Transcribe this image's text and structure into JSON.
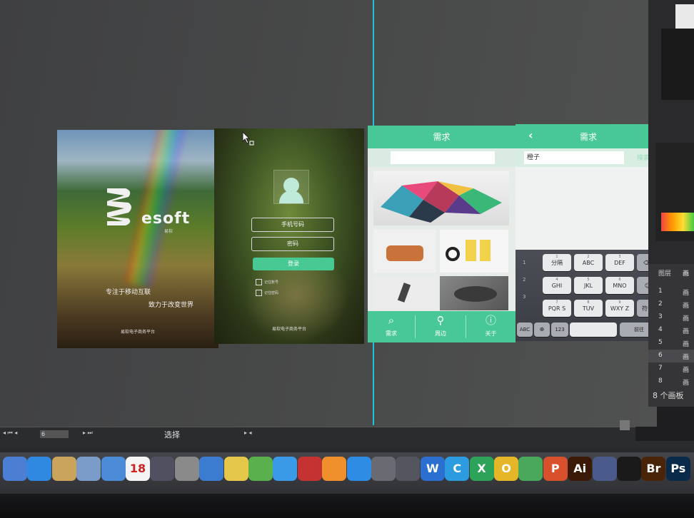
{
  "artboard1": {
    "brand": "esoft",
    "brand_sub": "易软",
    "tagline1": "专注于移动互联",
    "tagline2": "致力于改变世界",
    "footer": "易软电子商务平台"
  },
  "artboard2": {
    "phone_placeholder": "手机号码",
    "password_placeholder": "密码",
    "login_label": "登录",
    "remember_account": "记住账号",
    "remember_password": "记住密码",
    "footer": "易软电子商务平台"
  },
  "artboard3": {
    "title": "需求",
    "tabs": [
      {
        "icon": "search-icon",
        "label": "需求"
      },
      {
        "icon": "location-pin-icon",
        "label": "周边"
      },
      {
        "icon": "help-icon",
        "label": "关于"
      }
    ]
  },
  "artboard4": {
    "back": "‹",
    "title": "需求",
    "search_value": "橙子",
    "cancel": "搜索",
    "keys_row1": [
      {
        "n": "1",
        "l": "分隔"
      },
      {
        "n": "2",
        "l": "ABC"
      },
      {
        "n": "3",
        "l": "DEF"
      }
    ],
    "keys_row2": [
      {
        "n": "4",
        "l": "GHI"
      },
      {
        "n": "5",
        "l": "JKL"
      },
      {
        "n": "6",
        "l": "MNO"
      }
    ],
    "keys_row3": [
      {
        "n": "7",
        "l": "PQR S"
      },
      {
        "n": "8",
        "l": "TUV"
      },
      {
        "n": "9",
        "l": "WXY Z"
      }
    ],
    "side_keys": {
      "delete": "⌫",
      "emoji": "☺",
      "newline": "符号"
    },
    "bottom_keys": {
      "abc": "ABC",
      "globe": "⊕",
      "num": "123",
      "space": "",
      "go": "前往"
    },
    "left_nums": [
      "1",
      "2",
      "3"
    ]
  },
  "layers_panel": {
    "tabs": [
      "图层",
      "画"
    ],
    "rows": [
      {
        "num": "1",
        "name": "画"
      },
      {
        "num": "2",
        "name": "画"
      },
      {
        "num": "3",
        "name": "画"
      },
      {
        "num": "4",
        "name": "画"
      },
      {
        "num": "5",
        "name": "画"
      },
      {
        "num": "6",
        "name": "画"
      },
      {
        "num": "7",
        "name": "画"
      },
      {
        "num": "8",
        "name": "画"
      }
    ],
    "count": "8 个画板"
  },
  "status_bar": {
    "nav_left": "◂  ⏮  ◂",
    "page_value": "6",
    "nav_right": "▸  ⏭",
    "tool": "选择",
    "scroll_arrows": "▸ ◂"
  },
  "dock": {
    "items": [
      {
        "icon": "finder-icon",
        "label": "",
        "color": "#4a7fd4"
      },
      {
        "icon": "safari-icon",
        "label": "",
        "color": "#2f89e0"
      },
      {
        "icon": "contacts-icon",
        "label": "",
        "color": "#c9a45a"
      },
      {
        "icon": "preview-icon",
        "label": "",
        "color": "#7b9cc8"
      },
      {
        "icon": "mail-icon",
        "label": "",
        "color": "#4b8bd8"
      },
      {
        "icon": "calendar-icon",
        "label": "18",
        "color": "#f4f4f4"
      },
      {
        "icon": "photo-booth-icon",
        "label": "",
        "color": "#505060"
      },
      {
        "icon": "system-preferences-icon",
        "label": "",
        "color": "#8a8a8a"
      },
      {
        "icon": "keynote-icon",
        "label": "",
        "color": "#3b7bd0"
      },
      {
        "icon": "notes-icon",
        "label": "",
        "color": "#e5c84a"
      },
      {
        "icon": "numbers-icon",
        "label": "",
        "color": "#5ab04c"
      },
      {
        "icon": "itunes-icon",
        "label": "",
        "color": "#3a9ae8"
      },
      {
        "icon": "photo-app-icon",
        "label": "",
        "color": "#c43232"
      },
      {
        "icon": "ibooks-icon",
        "label": "",
        "color": "#f0902c"
      },
      {
        "icon": "app-store-icon",
        "label": "",
        "color": "#2f8ce4"
      },
      {
        "icon": "image-capture-icon",
        "label": "",
        "color": "#6a6a72"
      },
      {
        "icon": "screen-tool-icon",
        "label": "",
        "color": "#555560"
      },
      {
        "icon": "word-icon",
        "label": "W",
        "color": "#2b6fd0"
      },
      {
        "icon": "qq-browser-icon",
        "label": "C",
        "color": "#2c9be0"
      },
      {
        "icon": "excel-icon",
        "label": "X",
        "color": "#2da35a"
      },
      {
        "icon": "o-app-icon",
        "label": "O",
        "color": "#e5b628"
      },
      {
        "icon": "green-app-icon",
        "label": "",
        "color": "#4aa85a"
      },
      {
        "icon": "powerpoint-icon",
        "label": "P",
        "color": "#d8502c"
      },
      {
        "icon": "illustrator-icon",
        "label": "Ai",
        "color": "#3a1a06"
      },
      {
        "icon": "photo-viewer-icon",
        "label": "",
        "color": "#4a5a8a"
      },
      {
        "icon": "qq-icon",
        "label": "",
        "color": "#1a1a1a"
      },
      {
        "icon": "bridge-icon",
        "label": "Br",
        "color": "#4a2408"
      },
      {
        "icon": "photoshop-icon",
        "label": "Ps",
        "color": "#0a2a4a"
      }
    ]
  },
  "colors": {
    "accent_green": "#47c896",
    "guide_cyan": "#1ec3d8"
  }
}
